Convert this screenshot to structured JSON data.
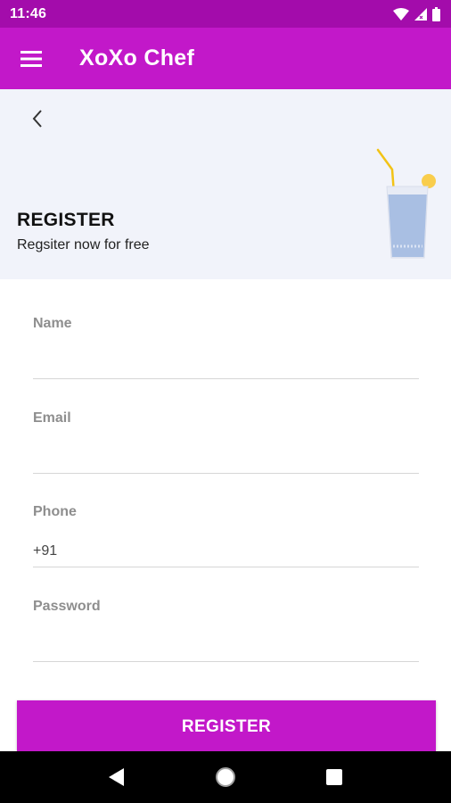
{
  "status_bar": {
    "time": "11:46",
    "icons": [
      "wifi-icon",
      "signal-icon",
      "battery-icon"
    ]
  },
  "app_bar": {
    "title": "XoXo Chef",
    "menu_icon": "hamburger-menu-icon",
    "color": "#c218c9"
  },
  "header": {
    "back_icon": "chevron-left-icon",
    "heading": "REGISTER",
    "subheading": "Regsiter now for free",
    "illustration": "drink-glass-illustration",
    "background": "#f1f3fa"
  },
  "form": {
    "fields": [
      {
        "label": "Name",
        "value": "",
        "placeholder": ""
      },
      {
        "label": "Email",
        "value": "",
        "placeholder": ""
      },
      {
        "label": "Phone",
        "value": "+91",
        "placeholder": ""
      },
      {
        "label": "Password",
        "value": "",
        "placeholder": ""
      }
    ],
    "submit_label": "REGISTER"
  },
  "nav_bar": {
    "icons": [
      "back-triangle-icon",
      "home-circle-icon",
      "recents-square-icon"
    ]
  },
  "colors": {
    "status_bar": "#a30cab",
    "accent": "#c218c9"
  }
}
